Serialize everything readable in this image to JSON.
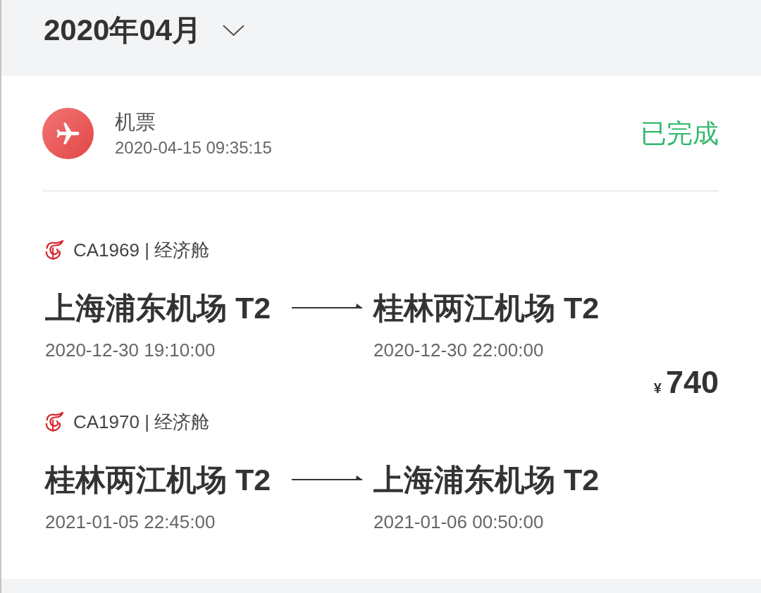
{
  "header": {
    "month": "2020年04月"
  },
  "order": {
    "category": "机票",
    "created": "2020-04-15 09:35:15",
    "status": "已完成",
    "currency": "¥",
    "price": "740"
  },
  "flights": [
    {
      "flight": "CA1969 | 经济舱",
      "from": "上海浦东机场 T2",
      "to": "桂林两江机场 T2",
      "depart": "2020-12-30 19:10:00",
      "arrive": "2020-12-30 22:00:00"
    },
    {
      "flight": "CA1970 | 经济舱",
      "from": "桂林两江机场 T2",
      "to": "上海浦东机场 T2",
      "depart": "2021-01-05 22:45:00",
      "arrive": "2021-01-06 00:50:00"
    }
  ]
}
